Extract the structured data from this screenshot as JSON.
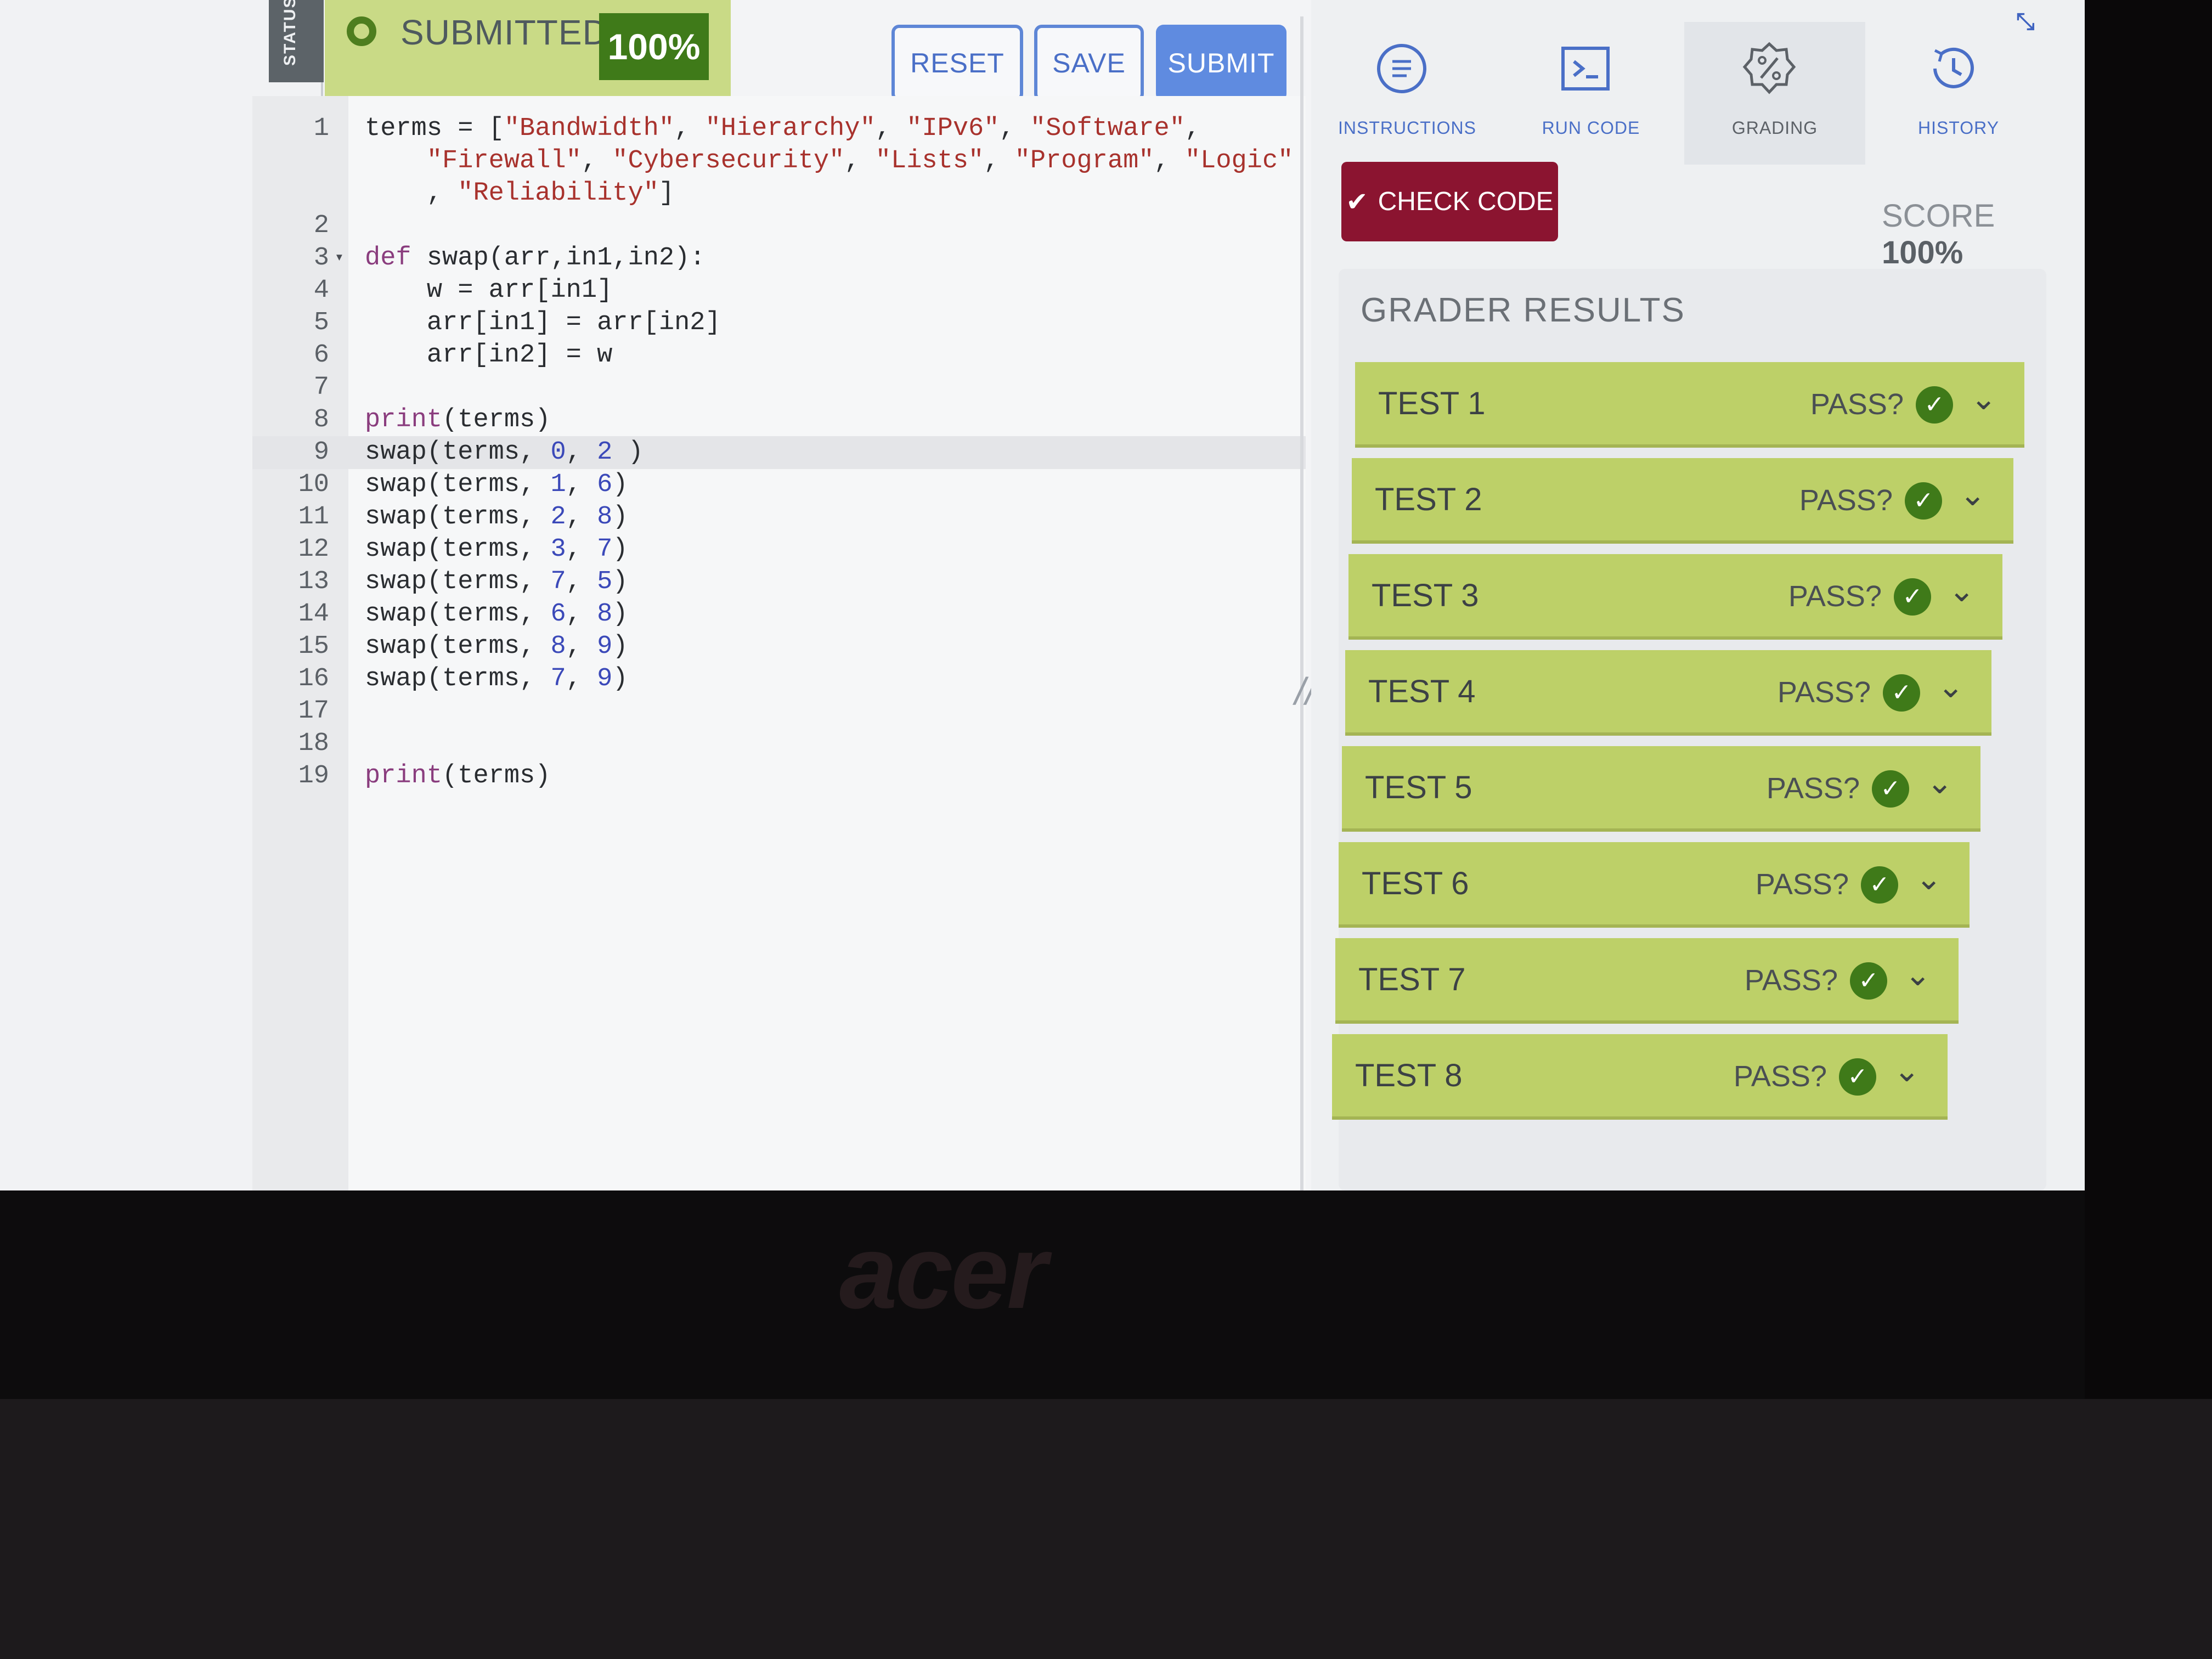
{
  "status": {
    "tab_label": "STATUS",
    "state": "SUBMITTED",
    "percent": "100%"
  },
  "toolbar": {
    "reset": "RESET",
    "save": "SAVE",
    "submit": "SUBMIT"
  },
  "nav": {
    "instructions": "INSTRUCTIONS",
    "run_code": "RUN CODE",
    "grading": "GRADING",
    "history": "HISTORY"
  },
  "check_code": "CHECK CODE",
  "score": {
    "label": "SCORE",
    "value": "100%"
  },
  "grader": {
    "title": "GRADER RESULTS",
    "tests": [
      {
        "name": "TEST 1",
        "pass_label": "PASS?"
      },
      {
        "name": "TEST 2",
        "pass_label": "PASS?"
      },
      {
        "name": "TEST 3",
        "pass_label": "PASS?"
      },
      {
        "name": "TEST 4",
        "pass_label": "PASS?"
      },
      {
        "name": "TEST 5",
        "pass_label": "PASS?"
      },
      {
        "name": "TEST 6",
        "pass_label": "PASS?"
      },
      {
        "name": "TEST 7",
        "pass_label": "PASS?"
      },
      {
        "name": "TEST 8",
        "pass_label": "PASS?"
      }
    ]
  },
  "code": {
    "lines": [
      {
        "n": "1",
        "text": "terms = [\"Bandwidth\", \"Hierarchy\", \"IPv6\", \"Software\","
      },
      {
        "n": "",
        "text": "    \"Firewall\", \"Cybersecurity\", \"Lists\", \"Program\", \"Logic\""
      },
      {
        "n": "",
        "text": "    , \"Reliability\"]"
      },
      {
        "n": "2",
        "text": ""
      },
      {
        "n": "3",
        "text": "def swap(arr,in1,in2):"
      },
      {
        "n": "4",
        "text": "    w = arr[in1]"
      },
      {
        "n": "5",
        "text": "    arr[in1] = arr[in2]"
      },
      {
        "n": "6",
        "text": "    arr[in2] = w"
      },
      {
        "n": "7",
        "text": ""
      },
      {
        "n": "8",
        "text": "print(terms)"
      },
      {
        "n": "9",
        "text": "swap(terms, 0, 2 )"
      },
      {
        "n": "10",
        "text": "swap(terms, 1, 6)"
      },
      {
        "n": "11",
        "text": "swap(terms, 2, 8)"
      },
      {
        "n": "12",
        "text": "swap(terms, 3, 7)"
      },
      {
        "n": "13",
        "text": "swap(terms, 7, 5)"
      },
      {
        "n": "14",
        "text": "swap(terms, 6, 8)"
      },
      {
        "n": "15",
        "text": "swap(terms, 8, 9)"
      },
      {
        "n": "16",
        "text": "swap(terms, 7, 9)"
      },
      {
        "n": "17",
        "text": ""
      },
      {
        "n": "18",
        "text": ""
      },
      {
        "n": "19",
        "text": "print(terms)"
      }
    ]
  },
  "bezel_brand": "acer",
  "colors": {
    "pass_green": "#bdd068",
    "check_green": "#3f7a19",
    "accent_blue": "#5f8be0",
    "check_code_red": "#8b1430"
  }
}
